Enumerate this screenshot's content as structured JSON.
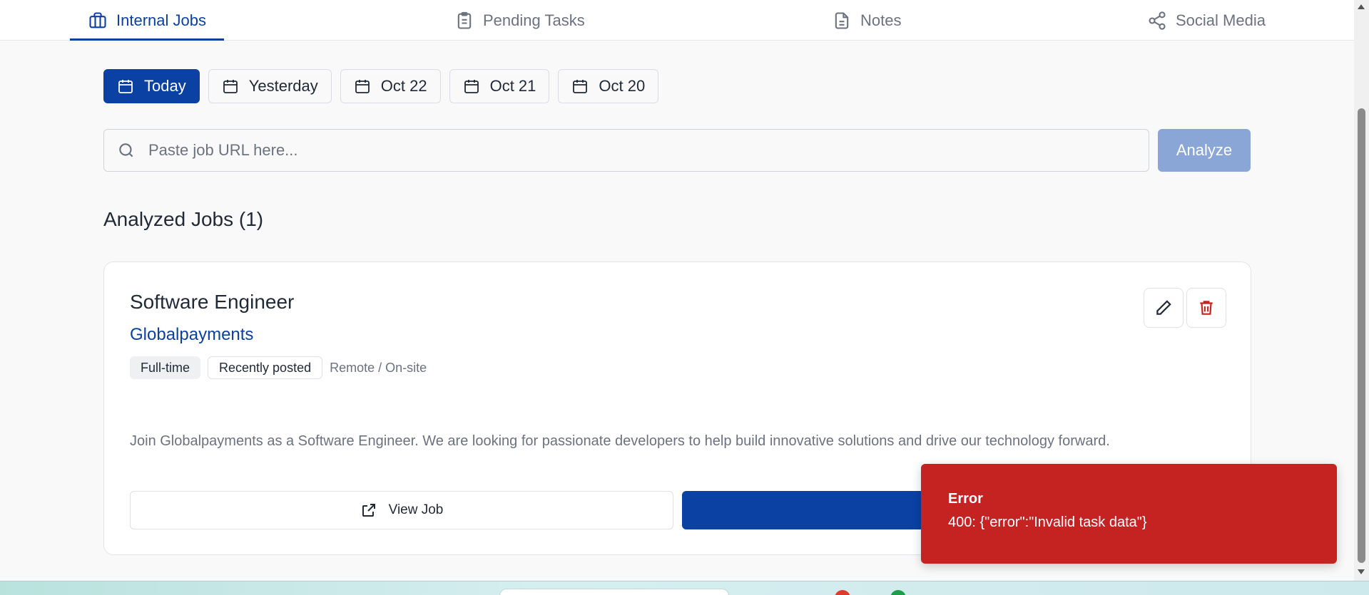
{
  "nav": {
    "tabs": [
      {
        "label": "Internal Jobs",
        "icon": "briefcase-icon",
        "active": true
      },
      {
        "label": "Pending Tasks",
        "icon": "clipboard-icon",
        "active": false
      },
      {
        "label": "Notes",
        "icon": "document-icon",
        "active": false
      },
      {
        "label": "Social Media",
        "icon": "share-icon",
        "active": false
      }
    ]
  },
  "dates": [
    {
      "label": "Today",
      "active": true
    },
    {
      "label": "Yesterday",
      "active": false
    },
    {
      "label": "Oct 22",
      "active": false
    },
    {
      "label": "Oct 21",
      "active": false
    },
    {
      "label": "Oct 20",
      "active": false
    }
  ],
  "search": {
    "placeholder": "Paste job URL here...",
    "value": "",
    "button_label": "Analyze"
  },
  "section": {
    "title": "Analyzed Jobs (1)"
  },
  "job": {
    "title": "Software Engineer",
    "company": "Globalpayments",
    "tags": [
      "Full-time",
      "Recently posted"
    ],
    "location": "Remote / On-site",
    "description": "Join Globalpayments as a Software Engineer. We are looking for passionate developers to help build innovative solutions and drive our technology forward.",
    "view_label": "View Job"
  },
  "toast": {
    "title": "Error",
    "message": "400: {\"error\":\"Invalid task data\"}"
  },
  "colors": {
    "primary": "#0b41a3",
    "error": "#c52222",
    "analyze_disabled": "#8aa6d6"
  }
}
